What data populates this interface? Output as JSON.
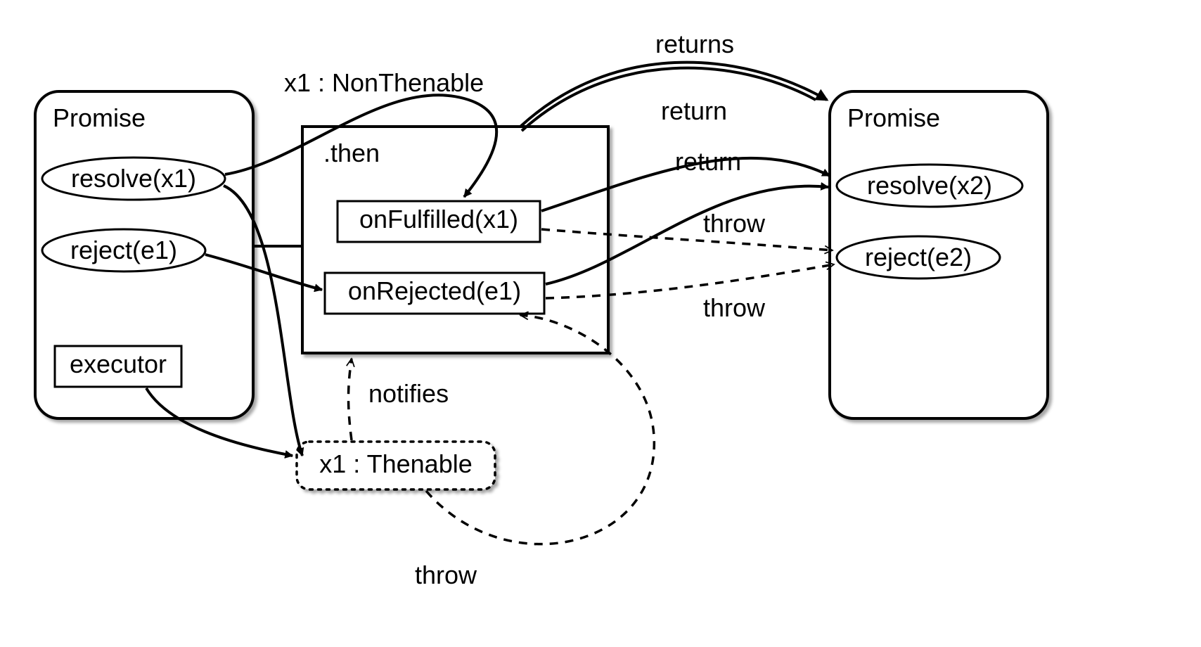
{
  "promiseLeft": {
    "title": "Promise",
    "resolve": "resolve(x1)",
    "reject": "reject(e1)",
    "executor": "executor"
  },
  "thenBox": {
    "label": ".then",
    "onFulfilled": "onFulfilled(x1)",
    "onRejected": "onRejected(e1)"
  },
  "promiseRight": {
    "title": "Promise",
    "resolve": "resolve(x2)",
    "reject": "reject(e2)"
  },
  "thenable": {
    "label": "x1 : Thenable"
  },
  "edges": {
    "nonThenable": "x1 : NonThenable",
    "returns": "returns",
    "return1": "return",
    "return2": "return",
    "throw1": "throw",
    "throw2": "throw",
    "notifies": "notifies",
    "throwLoop": "throw"
  }
}
